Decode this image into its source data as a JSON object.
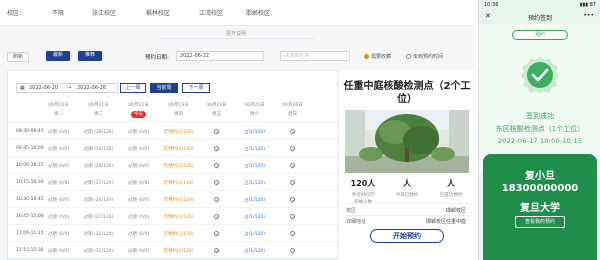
{
  "campus_bar": {
    "label": "校区：",
    "options": [
      "不限",
      "张江校区",
      "枫林校区",
      "江湾校区",
      "邯郸校区"
    ]
  },
  "expand_text": "展开说明",
  "toolbar": {
    "btn_refresh": "刷新",
    "btn_latest": "最新",
    "btn_recommend": "推荐",
    "date_label": "预约日期:",
    "date_value": "2022-06-22",
    "filter_placeholder": "请选择检测",
    "legend_full": "需要收藏",
    "legend_ok": "未到预约时间"
  },
  "schedule": {
    "range_start": "2022-06-20",
    "range_arrow": "→",
    "range_end": "2022-06-26",
    "nav_prev": "上一周",
    "nav_current": "当前周",
    "nav_next": "下一周",
    "dates": [
      "06月20日",
      "06月21日",
      "06月22日",
      "06月23日",
      "06月24日",
      "06月25日",
      "06月26日"
    ],
    "days": [
      "周一",
      "周二",
      "今天",
      "周四",
      "周五",
      "周六",
      "周日"
    ],
    "rows": [
      {
        "time": "09:30-09:45",
        "cells": [
          "过期 (0/0)",
          "过期 (28/120)",
          "过期 (0/0)",
          "可预约(1/120)",
          "ban",
          "占(1/120)",
          "ban"
        ]
      },
      {
        "time": "09:45-10:00",
        "cells": [
          "过期 (0/0)",
          "过期 (34/120)",
          "过期 (0/0)",
          "可预约(1/120)",
          "ban",
          "占(1/120)",
          "ban"
        ]
      },
      {
        "time": "10:00-10:15",
        "cells": [
          "过期 (0/0)",
          "过期 (28/120)",
          "过期 (0/0)",
          "可预约(1/120)",
          "ban",
          "占(1/120)",
          "ban"
        ]
      },
      {
        "time": "10:15-10:30",
        "cells": [
          "过期 (0/0)",
          "过期 (37/120)",
          "过期 (0/0)",
          "可预约(1/120)",
          "ban",
          "占(1/120)",
          "ban"
        ]
      },
      {
        "time": "10:30-10:45",
        "cells": [
          "过期 (0/0)",
          "过期 (26/120)",
          "过期 (0/0)",
          "可预约(1/120)",
          "ban",
          "占(1/120)",
          "ban"
        ]
      },
      {
        "time": "10:45-11:00",
        "cells": [
          "过期 (0/0)",
          "过期 (27/120)",
          "过期 (0/0)",
          "可预约(1/120)",
          "ban",
          "占(1/120)",
          "ban"
        ]
      },
      {
        "time": "11:00-11:15",
        "cells": [
          "过期 (0/0)",
          "过期 (22/120)",
          "过期 (0/0)",
          "可预约(1/120)",
          "ban",
          "占(1/120)",
          "ban"
        ]
      },
      {
        "time": "11:15-11:30",
        "cells": [
          "过期 (0/0)",
          "过期 (31/120)",
          "过期 (0/0)",
          "可预约(1/120)",
          "ban",
          "占(1/120)",
          "ban"
        ]
      }
    ]
  },
  "site": {
    "title": "任重中庭核酸检测点（2个工位）",
    "stats": [
      {
        "value": "120人",
        "label": "单位时间可"
      },
      {
        "value": "人",
        "label": "今日已预约"
      },
      {
        "value": "人",
        "label": "已成功预约"
      }
    ],
    "stat_sub": [
      "容纳人数",
      "",
      ""
    ],
    "kv": [
      {
        "key": "校区",
        "value": "邯郸校区"
      },
      {
        "key": "详细地址",
        "value": "邯郸校区任重中庭"
      }
    ],
    "start_button": "开始预约"
  },
  "phone": {
    "time": "10:36",
    "signal": "▮▮▮ 87",
    "title": "预约签到",
    "tab": "预约",
    "success_title": "签到成功",
    "success_site": "东区核酸检测点（1个工位）",
    "success_date": "2022-06-17  10:00-10:15",
    "name": "复小旦",
    "phone_no": "18300000000",
    "school": "复旦大学",
    "view_button": "查看我的预约"
  },
  "colors": {
    "brand": "#1f3f8f",
    "available": "#e08a1e",
    "expired": "#888888",
    "today": "#e5322d",
    "phone_green": "#1e8e4a"
  }
}
